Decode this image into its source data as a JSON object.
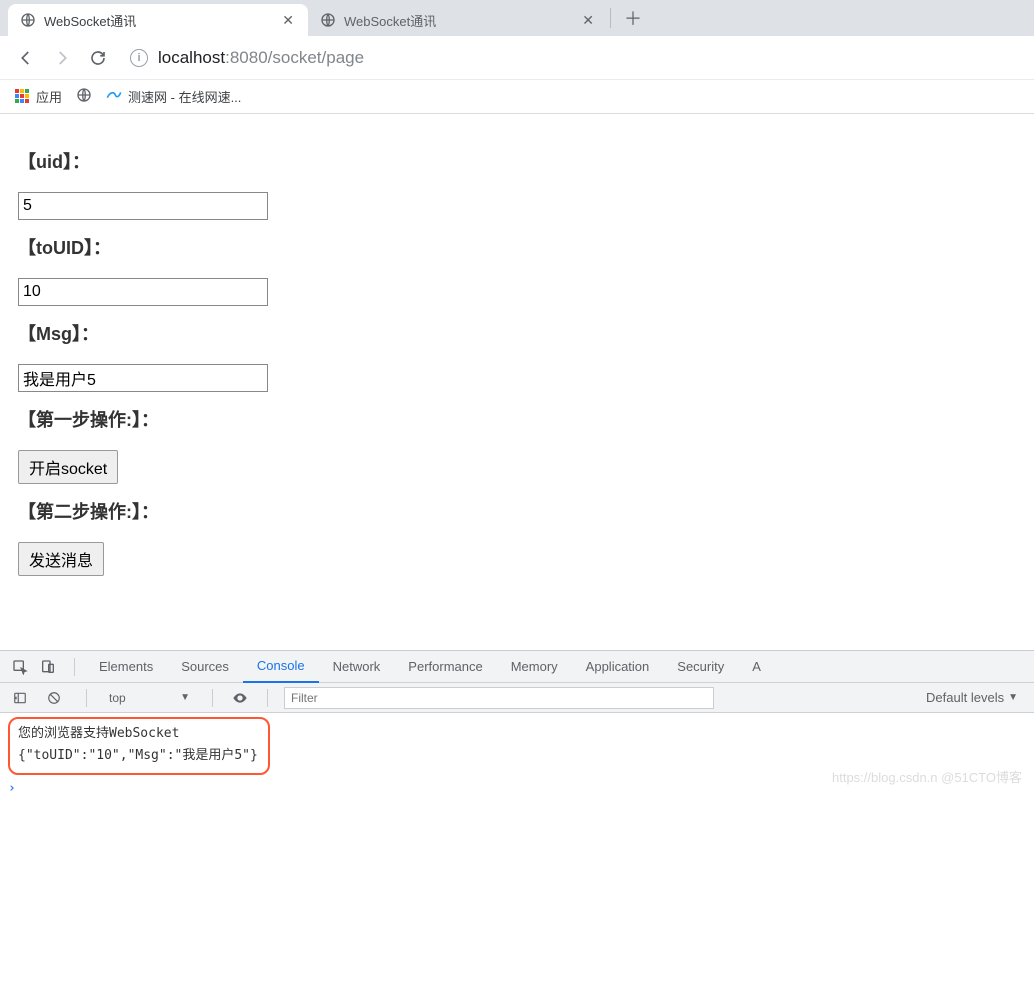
{
  "tabs": [
    {
      "title": "WebSocket通讯",
      "active": true
    },
    {
      "title": "WebSocket通讯",
      "active": false
    }
  ],
  "address": {
    "host": "localhost",
    "port": ":8080",
    "path": "/socket/page"
  },
  "bookmarks": {
    "apps_label": "应用",
    "item1_label": "测速网 - 在线网速..."
  },
  "form": {
    "uid_label": "【uid】：",
    "uid_value": "5",
    "touid_label": "【toUID】：",
    "touid_value": "10",
    "msg_label": "【Msg】：",
    "msg_value": "我是用户5",
    "step1_label": "【第一步操作:】：",
    "btn_open": "开启socket",
    "step2_label": "【第二步操作:】：",
    "btn_send": "发送消息"
  },
  "devtools": {
    "tabs": [
      "Elements",
      "Sources",
      "Console",
      "Network",
      "Performance",
      "Memory",
      "Application",
      "Security",
      "A"
    ],
    "active_tab": "Console",
    "context": "top",
    "filter_placeholder": "Filter",
    "levels": "Default levels",
    "log_line1": "您的浏览器支持WebSocket",
    "log_line2": "{\"toUID\":\"10\",\"Msg\":\"我是用户5\"}"
  },
  "watermark": "https://blog.csdn.n @51CTO博客"
}
